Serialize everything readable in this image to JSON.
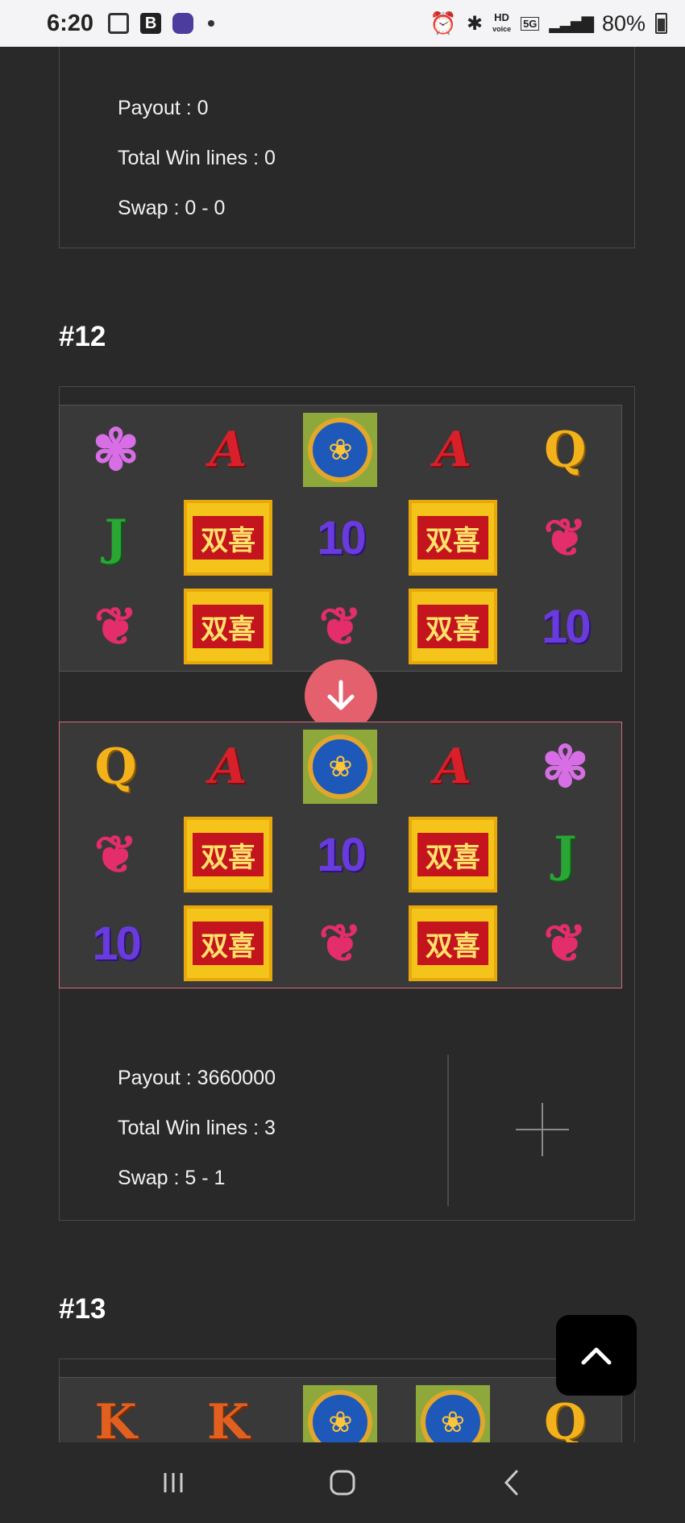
{
  "status_bar": {
    "time": "6:20",
    "b_label": "B",
    "hd_label": "HD",
    "voice_label": "voice",
    "net_label": "5G",
    "battery": "80%"
  },
  "rounds": [
    {
      "payout": "Payout : 0",
      "win_lines": "Total Win lines : 0",
      "swap": "Swap : 0 - 0"
    },
    {
      "title": "#12",
      "before": [
        [
          "BUTTERFLY",
          "A",
          "LOTUS",
          "A",
          "Q"
        ],
        [
          "J",
          "WILD",
          "10",
          "WILD",
          "BIRDS"
        ],
        [
          "BIRDS",
          "WILD",
          "BIRDS",
          "WILD",
          "10"
        ]
      ],
      "after": [
        [
          "Q",
          "A",
          "LOTUS",
          "A",
          "BUTTERFLY"
        ],
        [
          "BIRDS",
          "WILD",
          "10",
          "WILD",
          "J"
        ],
        [
          "10",
          "WILD",
          "BIRDS",
          "WILD",
          "BIRDS"
        ]
      ],
      "payout": "Payout : 3660000",
      "win_lines": "Total Win lines : 3",
      "swap": "Swap : 5 - 1"
    },
    {
      "title": "#13",
      "before": [
        [
          "K",
          "K",
          "LOTUS",
          "LOTUS",
          "Q"
        ]
      ]
    }
  ],
  "symbols": {
    "A": "A",
    "Q": "Q",
    "J": "J",
    "K": "K",
    "10": "10",
    "WILD": "双喜",
    "LOTUS": "❀",
    "BIRDS": "❦",
    "BUTTERFLY": "✾"
  },
  "icons": {
    "swap_arrow": "arrow-down-icon",
    "expand": "plus-icon",
    "scroll_top": "chevron-up-icon"
  },
  "colors": {
    "background": "#292929",
    "accent_pink": "#e4606c"
  }
}
